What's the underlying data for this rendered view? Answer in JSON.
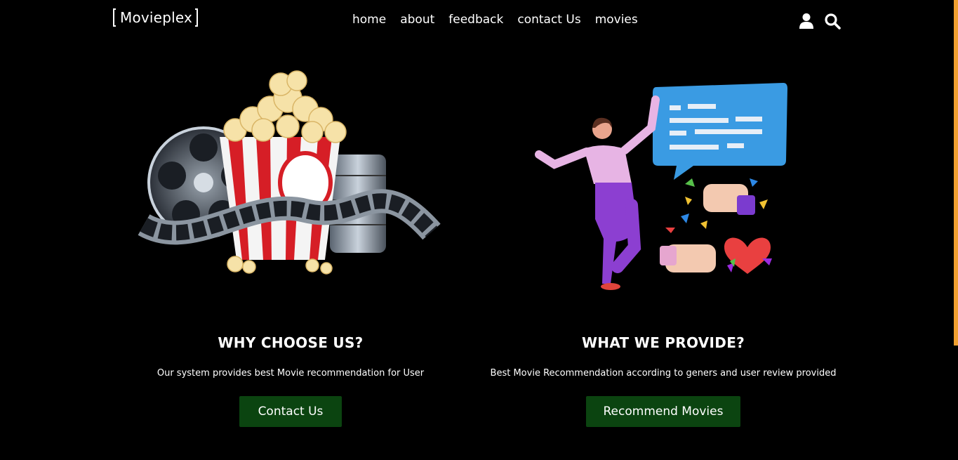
{
  "header": {
    "logo": "Movieplex",
    "nav": [
      "home",
      "about",
      "feedback",
      "contact Us",
      "movies"
    ],
    "icons": [
      "user-icon",
      "search-icon"
    ]
  },
  "cards": [
    {
      "title": "WHY CHOOSE US?",
      "text": "Our system provides best Movie recommendation for User",
      "button": "Contact Us",
      "illustration": "popcorn-film-reel"
    },
    {
      "title": "WHAT WE PROVIDE?",
      "text": "Best Movie Recommendation according to geners and user review provided",
      "button": "Recommend Movies",
      "illustration": "woman-feedback-chat"
    }
  ],
  "colors": {
    "background": "#000000",
    "button": "#0b4410",
    "scrollbar": "#f0a030"
  }
}
